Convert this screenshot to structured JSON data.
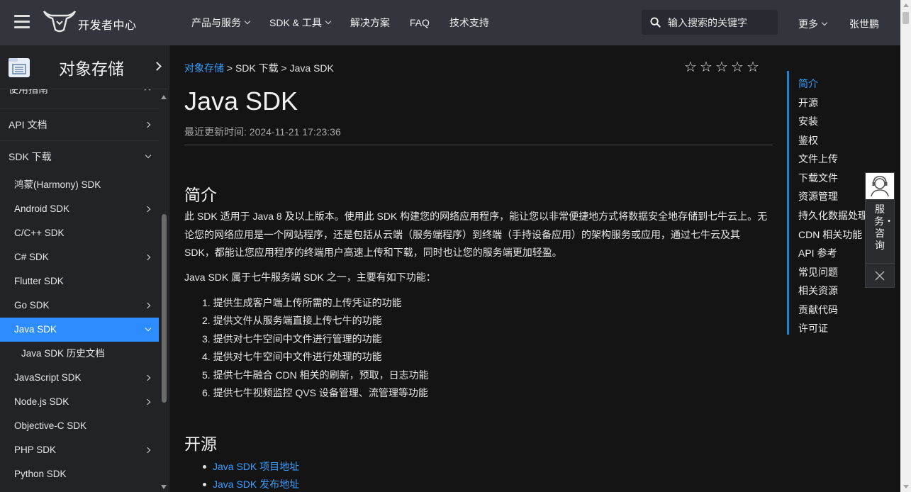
{
  "header": {
    "logo_text": "开发者中心",
    "nav": [
      {
        "label": "产品与服务",
        "has_dropdown": true
      },
      {
        "label": "SDK & 工具",
        "has_dropdown": true
      },
      {
        "label": "解决方案",
        "has_dropdown": false
      },
      {
        "label": "FAQ",
        "has_dropdown": false
      },
      {
        "label": "技术支持",
        "has_dropdown": false
      }
    ],
    "search_placeholder": "输入搜索的关键字",
    "more_label": "更多",
    "user_name": "张世鹏"
  },
  "sidebar": {
    "product_title": "对象存储",
    "items": [
      {
        "label": "使用指南",
        "level": 1,
        "icon": "chevron-right-icon"
      },
      {
        "label": "API 文档",
        "level": 1,
        "icon": "chevron-right-icon"
      },
      {
        "label": "SDK 下载",
        "level": 1,
        "icon": "chevron-down-icon"
      },
      {
        "label": "鸿蒙(Harmony) SDK",
        "level": 2,
        "icon": ""
      },
      {
        "label": "Android SDK",
        "level": 2,
        "icon": "chevron-right-icon"
      },
      {
        "label": "C/C++ SDK",
        "level": 2,
        "icon": ""
      },
      {
        "label": "C# SDK",
        "level": 2,
        "icon": "chevron-right-icon"
      },
      {
        "label": "Flutter SDK",
        "level": 2,
        "icon": ""
      },
      {
        "label": "Go SDK",
        "level": 2,
        "icon": "chevron-right-icon"
      },
      {
        "label": "Java SDK",
        "level": 2,
        "icon": "chevron-down-icon",
        "active": true
      },
      {
        "label": "Java SDK 历史文档",
        "level": 3,
        "icon": ""
      },
      {
        "label": "JavaScript SDK",
        "level": 2,
        "icon": "chevron-right-icon"
      },
      {
        "label": "Node.js SDK",
        "level": 2,
        "icon": "chevron-right-icon"
      },
      {
        "label": "Objective-C SDK",
        "level": 2,
        "icon": ""
      },
      {
        "label": "PHP SDK",
        "level": 2,
        "icon": "chevron-right-icon"
      },
      {
        "label": "Python SDK",
        "level": 2,
        "icon": ""
      }
    ]
  },
  "main": {
    "breadcrumb": {
      "link": "对象存储",
      "sep1": " > ",
      "mid": "SDK 下载",
      "sep2": " > ",
      "last": "Java SDK"
    },
    "rating_stars": 5,
    "title": "Java SDK",
    "updated": "最近更新时间: 2024-11-21 17:23:36",
    "sections": {
      "intro_heading": "简介",
      "intro_para": "此 SDK 适用于 Java 8 及以上版本。使用此 SDK 构建您的网络应用程序，能让您以非常便捷地方式将数据安全地存储到七牛云上。无论您的网络应用是一个网站程序，还是包括从云端（服务端程序）到终端（手持设备应用）的架构服务或应用，通过七牛云及其 SDK，都能让您应用程序的终端用户高速上传和下载，同时也让您的服务端更加轻盈。",
      "features_intro": "Java SDK 属于七牛服务端 SDK 之一，主要有如下功能：",
      "features": [
        "1. 提供生成客户端上传所需的上传凭证的功能",
        "2. 提供文件从服务端直接上传七牛的功能",
        "3. 提供对七牛空间中文件进行管理的功能",
        "4. 提供对七牛空间中文件进行处理的功能",
        "5. 提供七牛融合 CDN 相关的刷新，预取，日志功能",
        "6. 提供七牛视频监控 QVS 设备管理、流管理等功能"
      ],
      "open_heading": "开源",
      "open_links": [
        "Java SDK 项目地址",
        "Java SDK 发布地址"
      ]
    }
  },
  "toc": [
    "简介",
    "开源",
    "安装",
    "鉴权",
    "文件上传",
    "下载文件",
    "资源管理",
    "持久化数据处理",
    "CDN 相关功能",
    "API 参考",
    "常见问题",
    "相关资源",
    "贡献代码",
    "许可证"
  ],
  "service_widget": {
    "label": "服务・咨询"
  },
  "colors": {
    "accent": "#2d8cff",
    "link": "#3a9dff",
    "header_bg": "#32353c",
    "sidebar_bg": "#222326",
    "page_bg": "#141414"
  }
}
